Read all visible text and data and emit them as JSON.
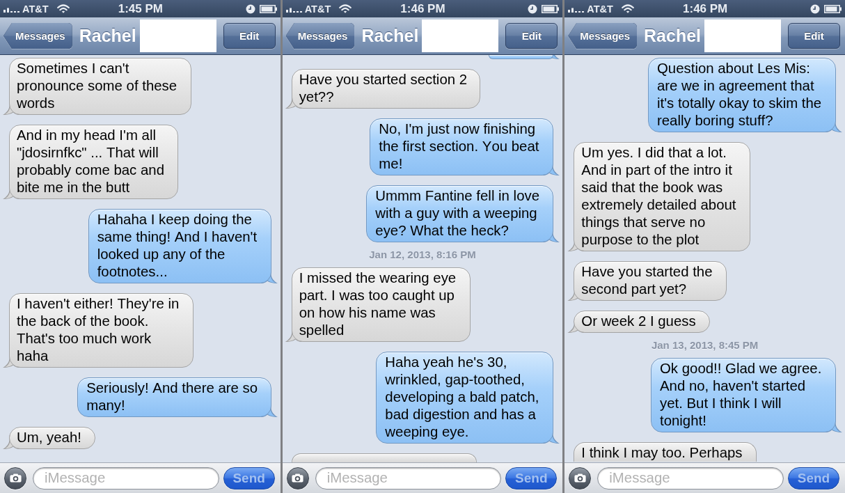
{
  "screens": [
    {
      "status_bar": {
        "carrier": "AT&T",
        "time": "1:45 PM"
      },
      "nav_bar": {
        "back_button": "Messages",
        "title": "Rachel",
        "name_redacted": true,
        "edit_button": "Edit"
      },
      "messages": [
        {
          "kind": "bubble",
          "from_me": false,
          "text": "Sometimes I can't pronounce some of these words"
        },
        {
          "kind": "bubble",
          "from_me": false,
          "text": "And in my head I'm all \"jdosirnfkc\" ... That will probably come bac and bite me in the butt"
        },
        {
          "kind": "bubble",
          "from_me": true,
          "text": "Hahaha I keep doing the same thing! And I haven't looked up any of the footnotes..."
        },
        {
          "kind": "bubble",
          "from_me": false,
          "text": "I haven't either! They're in the back of the book. That's too much work haha"
        },
        {
          "kind": "bubble",
          "from_me": true,
          "text": "Seriously! And there are so many!"
        },
        {
          "kind": "bubble",
          "from_me": false,
          "text": "Um, yeah!"
        }
      ],
      "composer": {
        "placeholder": "iMessage",
        "send_button": "Send",
        "send_disabled": true
      }
    },
    {
      "status_bar": {
        "carrier": "AT&T",
        "time": "1:46 PM"
      },
      "nav_bar": {
        "back_button": "Messages",
        "title": "Rachel",
        "name_redacted": true,
        "edit_button": "Edit"
      },
      "messages": [
        {
          "kind": "cut_top",
          "from_me": true
        },
        {
          "kind": "bubble",
          "from_me": false,
          "text": "Have you started section 2 yet??"
        },
        {
          "kind": "bubble",
          "from_me": true,
          "text": "No, I'm just now finishing the first section. You beat me!"
        },
        {
          "kind": "bubble",
          "from_me": true,
          "text": "Ummm Fantine fell in love with a guy with a weeping eye? What the heck?"
        },
        {
          "kind": "timestamp",
          "text": "Jan 12, 2013, 8:16 PM"
        },
        {
          "kind": "bubble",
          "from_me": false,
          "text": "I missed the wearing eye part. I was too caught up on how his name was spelled"
        },
        {
          "kind": "bubble",
          "from_me": true,
          "text": "Haha yeah he's 30, wrinkled, gap-toothed, developing a bald patch, bad digestion and has a weeping eye."
        },
        {
          "kind": "cut_bottom",
          "from_me": false
        }
      ],
      "composer": {
        "placeholder": "iMessage",
        "send_button": "Send",
        "send_disabled": true
      }
    },
    {
      "status_bar": {
        "carrier": "AT&T",
        "time": "1:46 PM"
      },
      "nav_bar": {
        "back_button": "Messages",
        "title": "Rachel",
        "name_redacted": true,
        "edit_button": "Edit"
      },
      "messages": [
        {
          "kind": "bubble",
          "from_me": true,
          "text": "Question about Les Mis: are we in agreement that it's totally okay to skim the really boring stuff?"
        },
        {
          "kind": "bubble",
          "from_me": false,
          "text": "Um yes. I did that a lot. And in part of the intro it said that the book was extremely detailed about things that serve no purpose to the plot"
        },
        {
          "kind": "bubble",
          "from_me": false,
          "text": "Have you started the second part yet?"
        },
        {
          "kind": "bubble",
          "from_me": false,
          "text": "Or week 2 I guess"
        },
        {
          "kind": "timestamp",
          "text": "Jan 13, 2013, 8:45 PM"
        },
        {
          "kind": "bubble",
          "from_me": true,
          "text": "Ok good!! Glad we agree. And no, haven't started yet. But I think I will tonight!"
        },
        {
          "kind": "cut_bottom",
          "from_me": false,
          "text": "I think I may too. Perhaps"
        }
      ],
      "composer": {
        "placeholder": "iMessage",
        "send_button": "Send",
        "send_disabled": true
      }
    }
  ]
}
